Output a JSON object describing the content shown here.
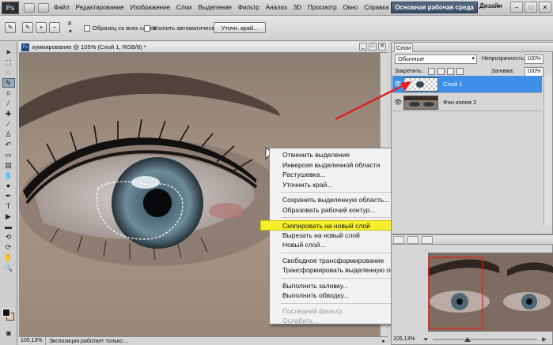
{
  "app": {
    "logo": "Ps",
    "menu": [
      "Файл",
      "Редактирование",
      "Изображение",
      "Слои",
      "Выделение",
      "Фильтр",
      "Анализ",
      "3D",
      "Просмотр",
      "Окно",
      "Справка"
    ],
    "zoom": "105%",
    "workspace": "Основная рабочая среда",
    "design": "Дизайн",
    "design_chevron": "»"
  },
  "options_bar": {
    "brush_size": "8",
    "sample_all_layers": "Образец со всех слоев",
    "auto_enhance": "Усилить автоматически",
    "refine_edge": "Уточн. край..."
  },
  "document": {
    "badge": "Ps",
    "title": "зуммирование @ 105% (Слой 1, RGB/8) *",
    "status_zoom": "105,13%",
    "status_text": "Экспозиция работает только ..."
  },
  "context_menu": {
    "groups": [
      [
        {
          "label": "Отменить выделение"
        },
        {
          "label": "Инверсия выделенной области"
        },
        {
          "label": "Растушевка..."
        },
        {
          "label": "Уточнить край..."
        }
      ],
      [
        {
          "label": "Сохранить выделенную область..."
        },
        {
          "label": "Образовать рабочий контур..."
        }
      ],
      [
        {
          "label": "Скопировать на новый слой",
          "highlighted": true
        },
        {
          "label": "Вырезать на новый слой"
        },
        {
          "label": "Новый слой..."
        }
      ],
      [
        {
          "label": "Свободное трансформирование"
        },
        {
          "label": "Трансформировать выделенную область"
        }
      ],
      [
        {
          "label": "Выполнить заливку..."
        },
        {
          "label": "Выполнить обводку..."
        }
      ],
      [
        {
          "label": "Последний фильтр",
          "disabled": true
        },
        {
          "label": "Ослабить...",
          "disabled": true
        }
      ]
    ]
  },
  "layers_panel": {
    "tab": "Слои",
    "blend_mode": "Обычные",
    "opacity_label": "Непрозрачность:",
    "opacity": "100%",
    "lock_label": "Закрепить:",
    "fill_label": "Заливка:",
    "fill": "100%",
    "layers": [
      {
        "name": "Слой 1",
        "selected": true
      },
      {
        "name": "Фон копия 2",
        "selected": false
      }
    ]
  },
  "navigator": {
    "zoom": "105,13%"
  },
  "colors": {
    "accent_selected": "#3d8fe8",
    "highlight": "#f6f02c",
    "arrow": "#e0201c"
  }
}
